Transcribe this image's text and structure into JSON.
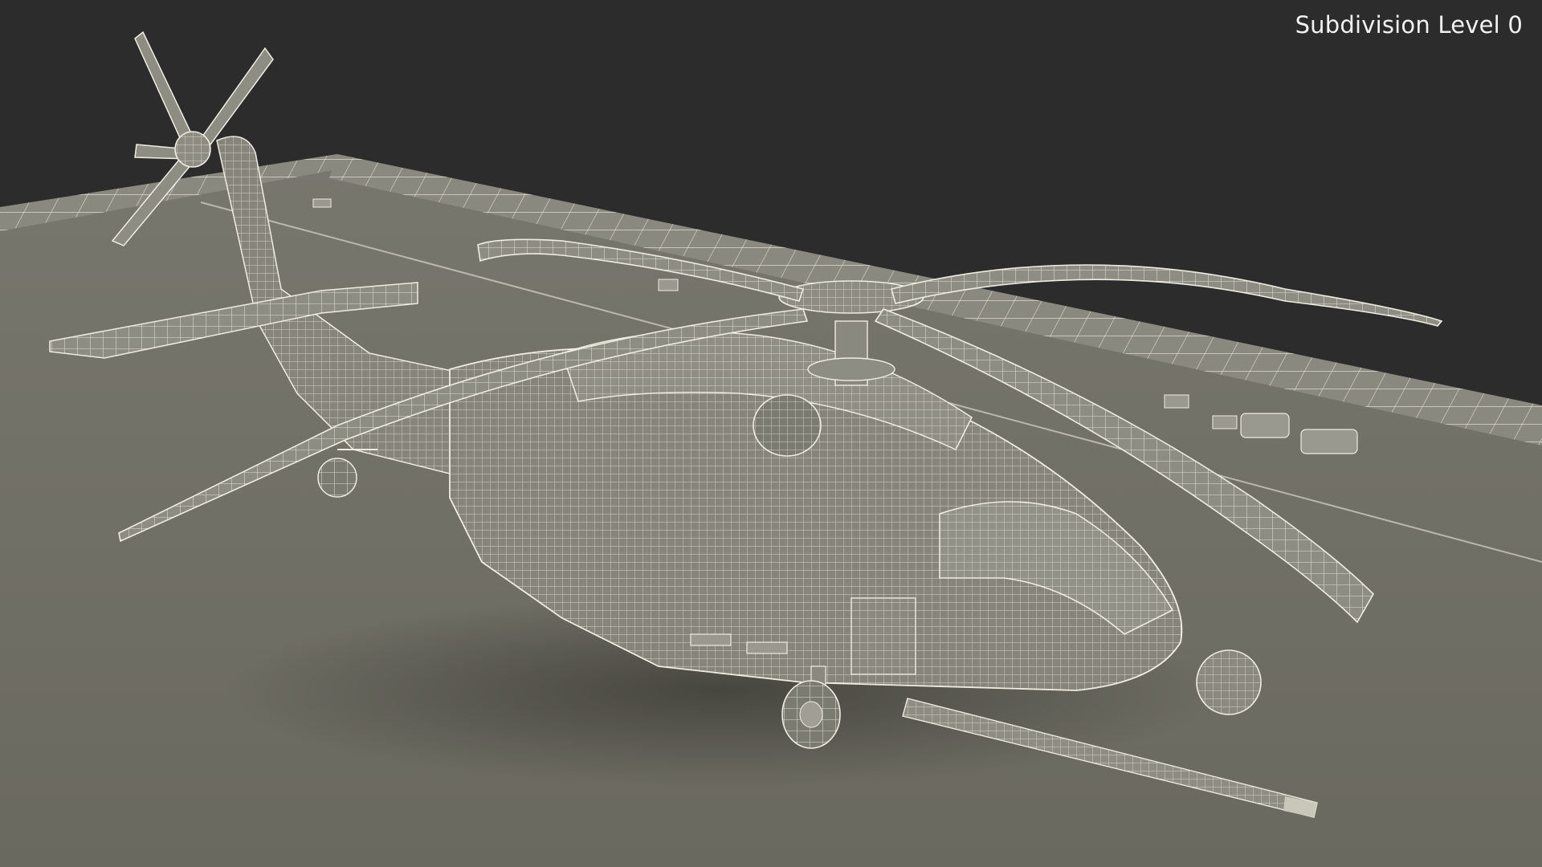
{
  "viewport": {
    "label": "Subdivision Level 0",
    "background_color": "#2c2c2c",
    "ground_color": "#717067",
    "wireframe_color": "#efece0",
    "model_fill_color": "#86857c"
  }
}
